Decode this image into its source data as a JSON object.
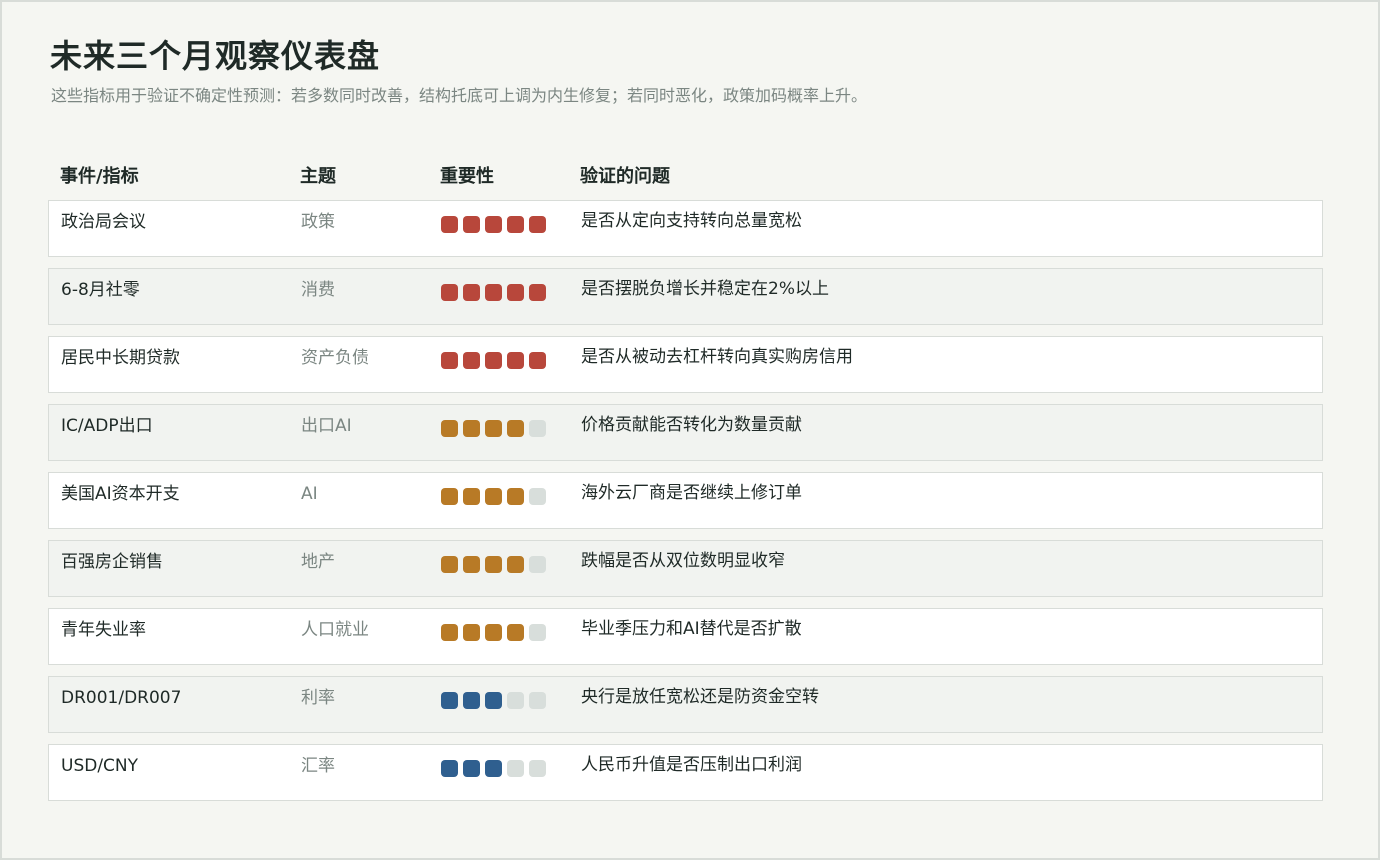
{
  "page": {
    "title": "未来三个月观察仪表盘",
    "subtitle": "这些指标用于验证不确定性预测：若多数同时改善，结构托底可上调为内生修复；若同时恶化，政策加码概率上升。"
  },
  "colors": {
    "high": "#b8473b",
    "medium": "#b87a26",
    "low": "#2f5f8f",
    "empty": "#d8dedb"
  },
  "table": {
    "headers": {
      "event": "事件/指标",
      "topic": "主题",
      "importance": "重要性",
      "question": "验证的问题"
    },
    "rows": [
      {
        "event": "政治局会议",
        "topic": "政策",
        "importance": 5,
        "level": "high",
        "question": "是否从定向支持转向总量宽松"
      },
      {
        "event": "6-8月社零",
        "topic": "消费",
        "importance": 5,
        "level": "high",
        "question": "是否摆脱负增长并稳定在2%以上"
      },
      {
        "event": "居民中长期贷款",
        "topic": "资产负债",
        "importance": 5,
        "level": "high",
        "question": "是否从被动去杠杆转向真实购房信用"
      },
      {
        "event": "IC/ADP出口",
        "topic": "出口AI",
        "importance": 4,
        "level": "medium",
        "question": "价格贡献能否转化为数量贡献"
      },
      {
        "event": "美国AI资本开支",
        "topic": "AI",
        "importance": 4,
        "level": "medium",
        "question": "海外云厂商是否继续上修订单"
      },
      {
        "event": "百强房企销售",
        "topic": "地产",
        "importance": 4,
        "level": "medium",
        "question": "跌幅是否从双位数明显收窄"
      },
      {
        "event": "青年失业率",
        "topic": "人口就业",
        "importance": 4,
        "level": "medium",
        "question": "毕业季压力和AI替代是否扩散"
      },
      {
        "event": "DR001/DR007",
        "topic": "利率",
        "importance": 3,
        "level": "low",
        "question": "央行是放任宽松还是防资金空转"
      },
      {
        "event": "USD/CNY",
        "topic": "汇率",
        "importance": 3,
        "level": "low",
        "question": "人民币升值是否压制出口利润"
      }
    ]
  }
}
